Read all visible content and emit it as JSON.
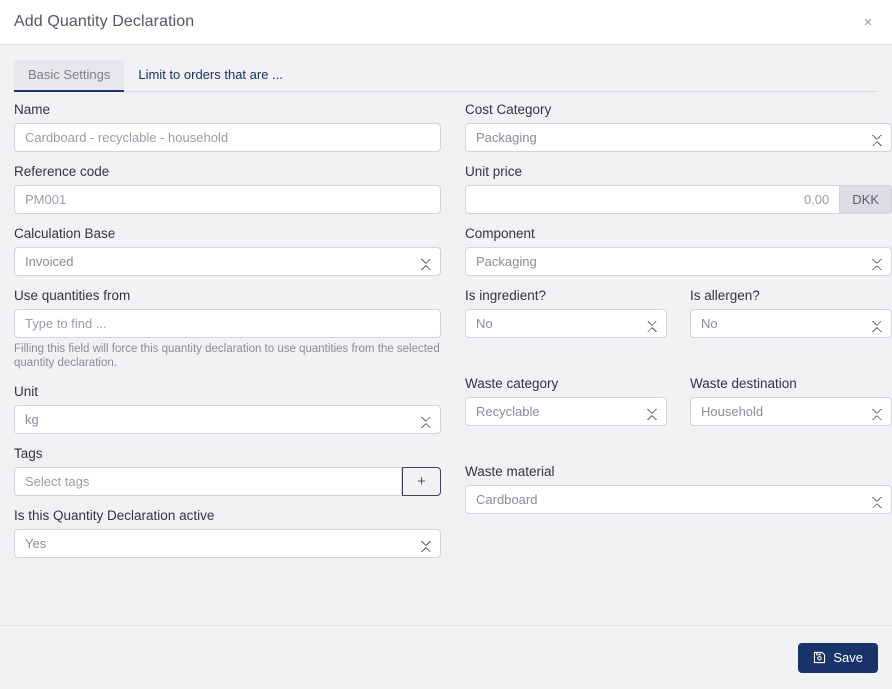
{
  "header": {
    "title": "Add Quantity Declaration",
    "close_label": "×"
  },
  "tabs": [
    {
      "label": "Basic Settings",
      "active": true
    },
    {
      "label": "Limit to orders that are ...",
      "active": false
    }
  ],
  "form": {
    "name": {
      "label": "Name",
      "placeholder": "Cardboard - recyclable - household",
      "value": ""
    },
    "reference_code": {
      "label": "Reference code",
      "placeholder": "PM001",
      "value": ""
    },
    "calculation_base": {
      "label": "Calculation Base",
      "value": "Invoiced"
    },
    "use_quantities_from": {
      "label": "Use quantities from",
      "placeholder": "Type to find ...",
      "value": "",
      "help": "Filling this field will force this quantity declaration to use quantities from the selected quantity declaration."
    },
    "unit": {
      "label": "Unit",
      "value": "kg"
    },
    "tags": {
      "label": "Tags",
      "placeholder": "Select tags",
      "value": "",
      "add_label": "+"
    },
    "is_active": {
      "label": "Is this Quantity Declaration active",
      "value": "Yes"
    },
    "cost_category": {
      "label": "Cost Category",
      "value": "Packaging"
    },
    "unit_price": {
      "label": "Unit price",
      "placeholder": "0,00",
      "value": "",
      "currency": "DKK"
    },
    "component": {
      "label": "Component",
      "value": "Packaging"
    },
    "is_ingredient": {
      "label": "Is ingredient?",
      "value": "No"
    },
    "is_allergen": {
      "label": "Is allergen?",
      "value": "No"
    },
    "waste_category": {
      "label": "Waste category",
      "value": "Recyclable"
    },
    "waste_destination": {
      "label": "Waste destination",
      "value": "Household"
    },
    "waste_material": {
      "label": "Waste material",
      "value": "Cardboard"
    }
  },
  "footer": {
    "save_label": "Save",
    "save_icon": "save-floppy-icon"
  },
  "colors": {
    "accent": "#19336b",
    "page_bg": "#f2f2f5",
    "header_bg": "#ffffff",
    "border": "#d3d3dc",
    "tag_add_border": "#473a5e"
  }
}
